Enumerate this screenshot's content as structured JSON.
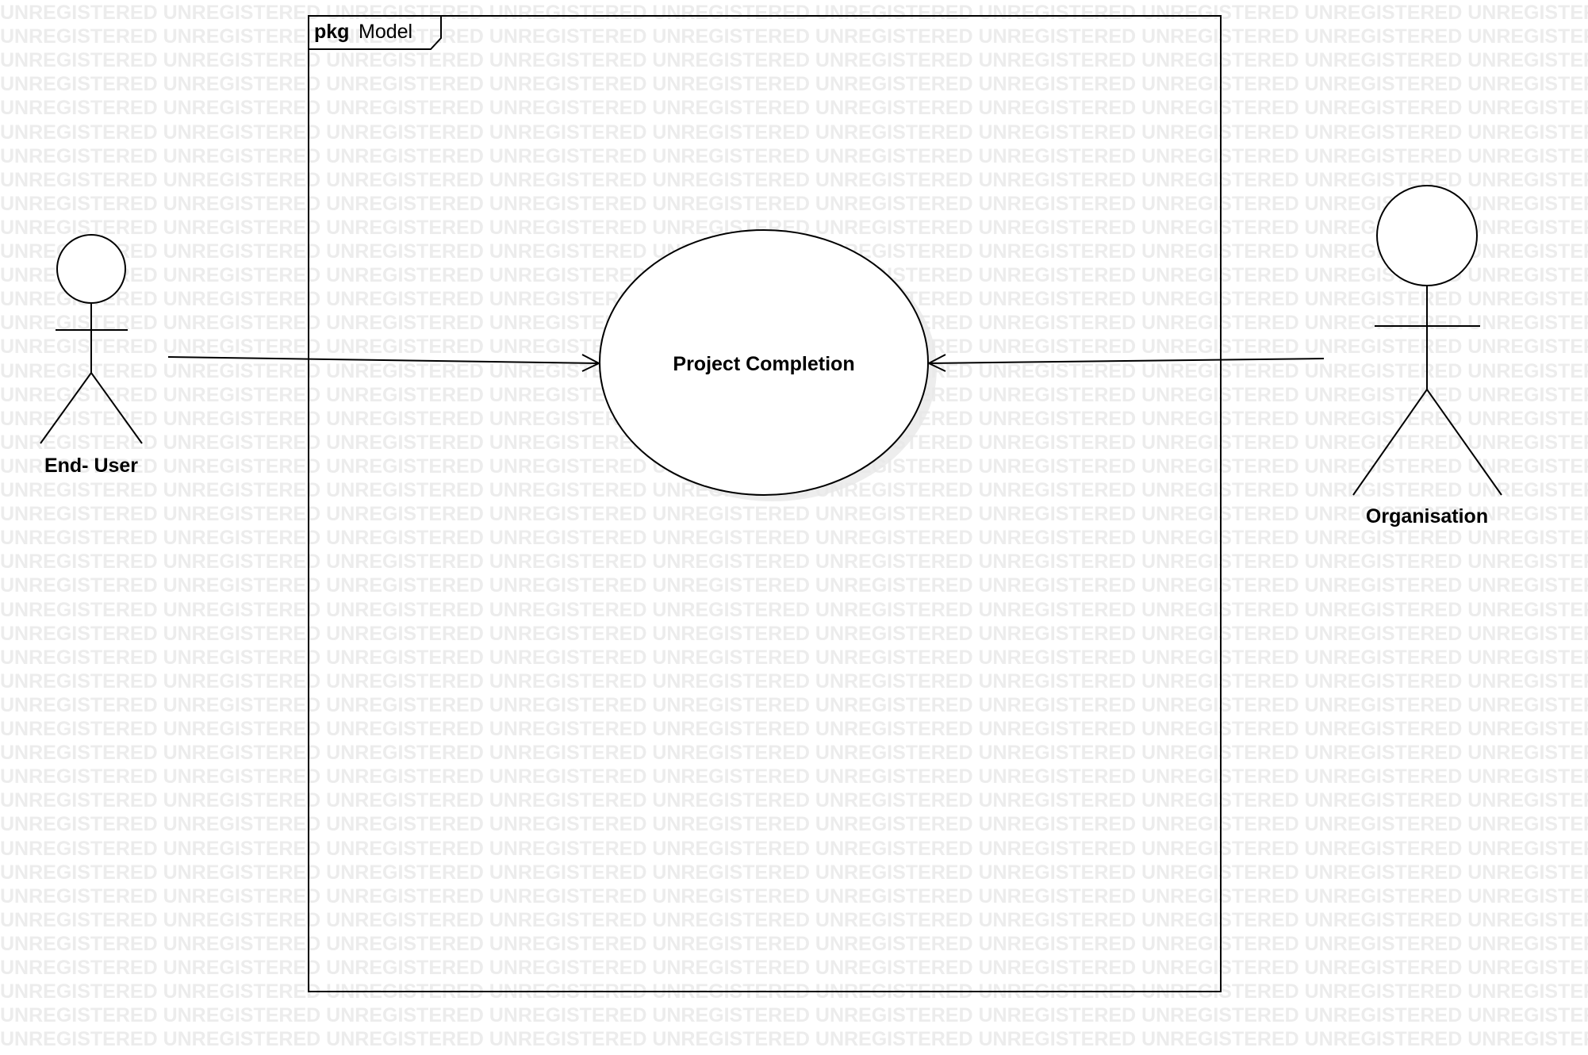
{
  "watermark": {
    "text": "UNREGISTERED"
  },
  "package": {
    "keyword": "pkg",
    "name": "Model"
  },
  "use_case": {
    "label": "Project Completion"
  },
  "actors": [
    {
      "name": "End- User"
    },
    {
      "name": "Organisation"
    }
  ],
  "colors": {
    "stroke": "#000000",
    "background": "#ffffff",
    "watermark": "#ececec",
    "shadow": "#e6e6e6"
  }
}
